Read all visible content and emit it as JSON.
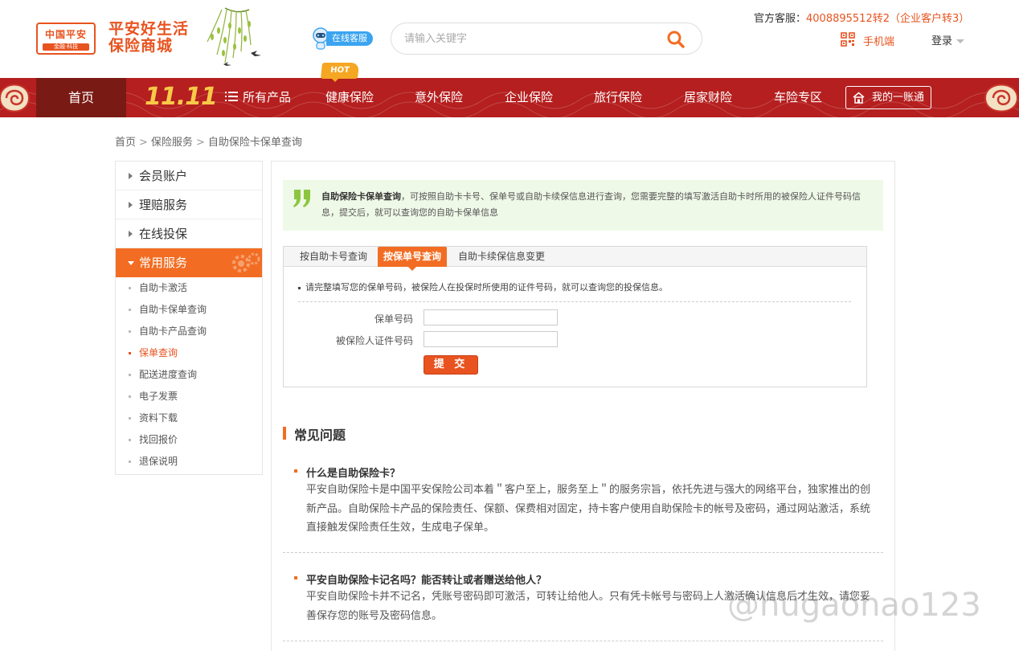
{
  "header": {
    "logo_line1": "中国平安",
    "logo_line2": "金融·科技",
    "slogan_line1": "平安好生活",
    "slogan_line2": "保险商城",
    "online_service": "在线客服",
    "search_placeholder": "请输入关键字",
    "hotline_label": "官方客服：",
    "hotline_number": "4008895512转2（企业客户转3）",
    "mobile_label": "手机端",
    "login_label": "登录"
  },
  "nav": {
    "home": "首页",
    "promo": "11.11",
    "hot_badge": "HOT",
    "items": [
      "所有产品",
      "健康保险",
      "意外保险",
      "企业保险",
      "旅行保险",
      "居家财险",
      "车险专区"
    ],
    "account": "我的一账通"
  },
  "breadcrumb": [
    "首页",
    "保险服务",
    "自助保险卡保单查询"
  ],
  "sidebar": {
    "sections": [
      "会员账户",
      "理赔服务",
      "在线投保",
      "常用服务"
    ],
    "sub_items": [
      "自助卡激活",
      "自助卡保单查询",
      "自助卡产品查询",
      "保单查询",
      "配送进度查询",
      "电子发票",
      "资料下载",
      "找回报价",
      "退保说明"
    ],
    "active_sub": "保单查询"
  },
  "intro": {
    "title": "自助保险卡保单查询",
    "text": "，可按照自助卡卡号、保单号或自助卡续保信息进行查询，您需要完整的填写激活自助卡时所用的被保险人证件号码信息，提交后，就可以查询您的自助卡保单信息"
  },
  "query": {
    "tabs": [
      "按自助卡号查询",
      "按保单号查询",
      "自助卡续保信息变更"
    ],
    "active_tab": "按保单号查询",
    "note": "请完整填写您的保单号码，被保险人在投保时所使用的证件号码，就可以查询您的投保信息。",
    "policy_label": "保单号码",
    "id_label": "被保险人证件号码",
    "policy_value": "",
    "id_value": "",
    "submit": "提 交"
  },
  "faq": {
    "title": "常见问题",
    "items": [
      {
        "q": "什么是自助保险卡？",
        "a": "平安自助保险卡是中国平安保险公司本着＂客户至上，服务至上＂的服务宗旨，依托先进与强大的网络平台，独家推出的创新产品。自助保险卡产品的保险责任、保额、保费相对固定，持卡客户使用自助保险卡的帐号及密码，通过网站激活，系统直接触发保险责任生效，生成电子保单。"
      },
      {
        "q": "平安自助保险卡记名吗？能否转让或者赠送给他人？",
        "a": "平安自助保险卡并不记名，凭账号密码即可激活，可转让给他人。只有凭卡帐号与密码上人激活确认信息后才生效，请您妥善保存您的账号及密码信息。"
      }
    ]
  },
  "watermark": "@hugaohao123",
  "colors": {
    "brand_orange": "#e8531f",
    "nav_red": "#b51f1f",
    "active_tab": "#f26d23",
    "intro_bg": "#eff9e7",
    "promo_gold": "#f7c948"
  }
}
